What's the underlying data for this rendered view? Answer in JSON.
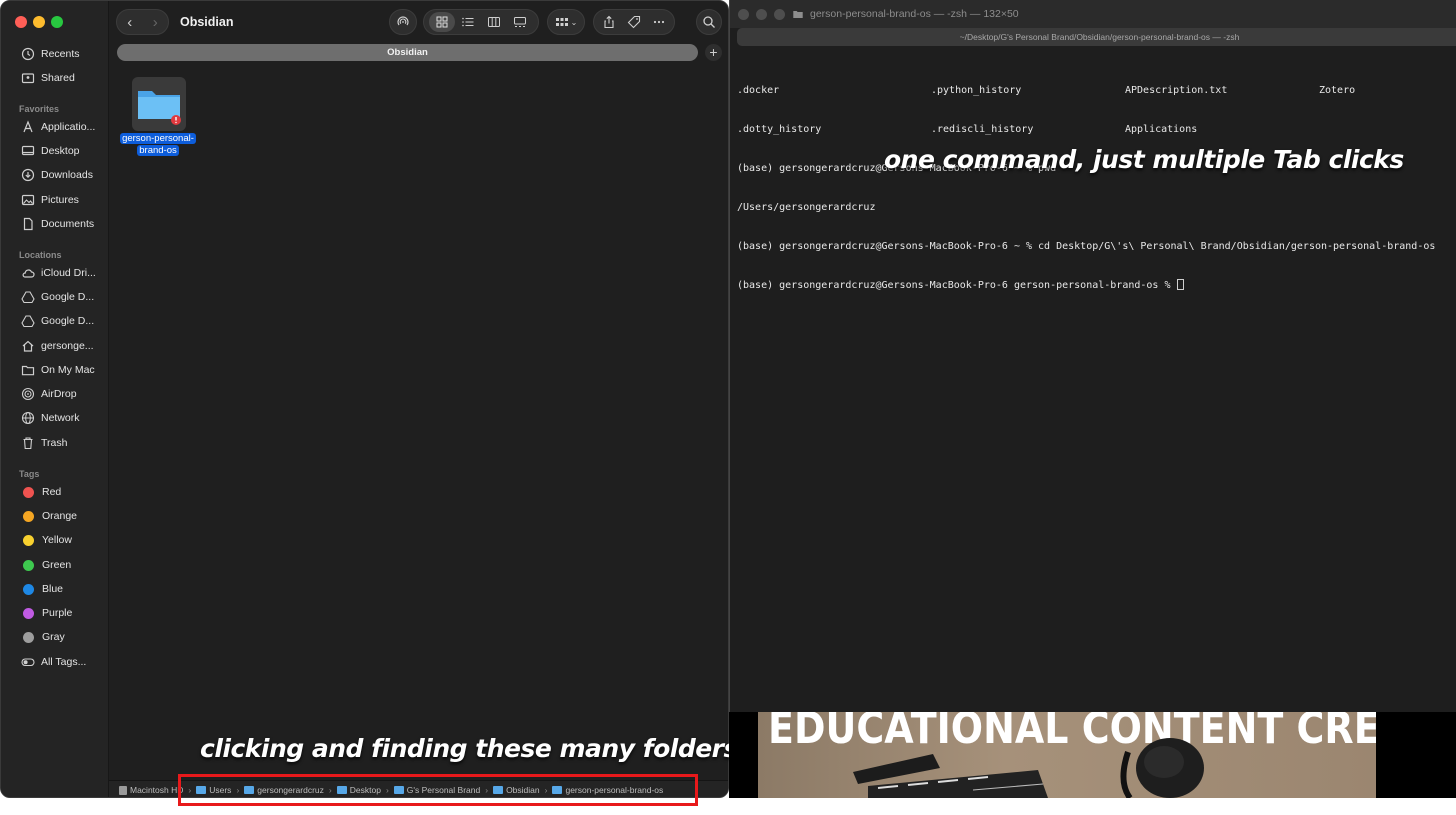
{
  "finder": {
    "title": "Obsidian",
    "tab_label": "Obsidian",
    "tab_add": "+",
    "sidebar": {
      "top_items": [
        {
          "label": "Recents",
          "icon": "clock-icon"
        },
        {
          "label": "Shared",
          "icon": "shared-folder-icon"
        }
      ],
      "favorites_header": "Favorites",
      "favorites": [
        {
          "label": "Applicatio...",
          "icon": "applications-icon"
        },
        {
          "label": "Desktop",
          "icon": "desktop-icon"
        },
        {
          "label": "Downloads",
          "icon": "download-icon"
        },
        {
          "label": "Pictures",
          "icon": "pictures-icon"
        },
        {
          "label": "Documents",
          "icon": "document-icon"
        }
      ],
      "locations_header": "Locations",
      "locations": [
        {
          "label": "iCloud Dri...",
          "icon": "cloud-icon"
        },
        {
          "label": "Google D...",
          "icon": "drive-icon"
        },
        {
          "label": "Google D...",
          "icon": "drive-icon"
        },
        {
          "label": "gersonge...",
          "icon": "home-icon"
        },
        {
          "label": "On My Mac",
          "icon": "folder-icon"
        },
        {
          "label": "AirDrop",
          "icon": "airdrop-icon"
        },
        {
          "label": "Network",
          "icon": "globe-icon"
        },
        {
          "label": "Trash",
          "icon": "trash-icon"
        }
      ],
      "tags_header": "Tags",
      "tags": [
        {
          "label": "Red",
          "color": "#ef5350"
        },
        {
          "label": "Orange",
          "color": "#f5a623"
        },
        {
          "label": "Yellow",
          "color": "#f8d12f"
        },
        {
          "label": "Green",
          "color": "#3ec94f"
        },
        {
          "label": "Blue",
          "color": "#1e88e5"
        },
        {
          "label": "Purple",
          "color": "#c05be3"
        },
        {
          "label": "Gray",
          "color": "#9e9e9e"
        },
        {
          "label": "All Tags...",
          "icon": "all-tags-icon"
        }
      ]
    },
    "content": {
      "folder_name": "gerson-personal-brand-os",
      "folder_name_line1": "gerson-personal-",
      "folder_name_line2": "brand-os"
    },
    "path_bar": [
      {
        "label": "Macintosh HD",
        "icon": "disk-icon"
      },
      {
        "label": "Users",
        "icon": "folder-icon"
      },
      {
        "label": "gersongerardcruz",
        "icon": "folder-icon"
      },
      {
        "label": "Desktop",
        "icon": "folder-icon"
      },
      {
        "label": "G's Personal Brand",
        "icon": "folder-icon"
      },
      {
        "label": "Obsidian",
        "icon": "folder-icon"
      },
      {
        "label": "gerson-personal-brand-os",
        "icon": "folder-icon"
      }
    ],
    "path_separator": "›"
  },
  "terminal": {
    "title": "gerson-personal-brand-os — -zsh — 132×50",
    "tab_path": "~/Desktop/G's Personal Brand/Obsidian/gerson-personal-brand-os — -zsh",
    "ls_row1": [
      ".docker",
      ".python_history",
      "APDescription.txt",
      "Zotero"
    ],
    "ls_row2": [
      ".dotty_history",
      ".rediscli_history",
      "Applications"
    ],
    "line_pwd": "(base) gersongerardcruz@Gersons-MacBook-Pro-6 ~ % pwd",
    "line_pwd_out": "/Users/gersongerardcruz",
    "line_cd": "(base) gersongerardcruz@Gersons-MacBook-Pro-6 ~ % cd Desktop/G\\'s\\ Personal\\ Brand/Obsidian/gerson-personal-brand-os",
    "line_prompt": "(base) gersongerardcruz@Gersons-MacBook-Pro-6 gerson-personal-brand-os % "
  },
  "captions": {
    "terminal_caption": "one command, just multiple Tab clicks",
    "finder_caption": "clicking and finding these many folders"
  },
  "background": {
    "thumbnail_text": "EDUCATIONAL CONTENT CREATION"
  },
  "colors": {
    "traffic_red": "#ff5f57",
    "traffic_yellow": "#febc2e",
    "traffic_green": "#28c840",
    "selection_blue": "#0d5ddb",
    "highlight_red": "#e8191b"
  }
}
